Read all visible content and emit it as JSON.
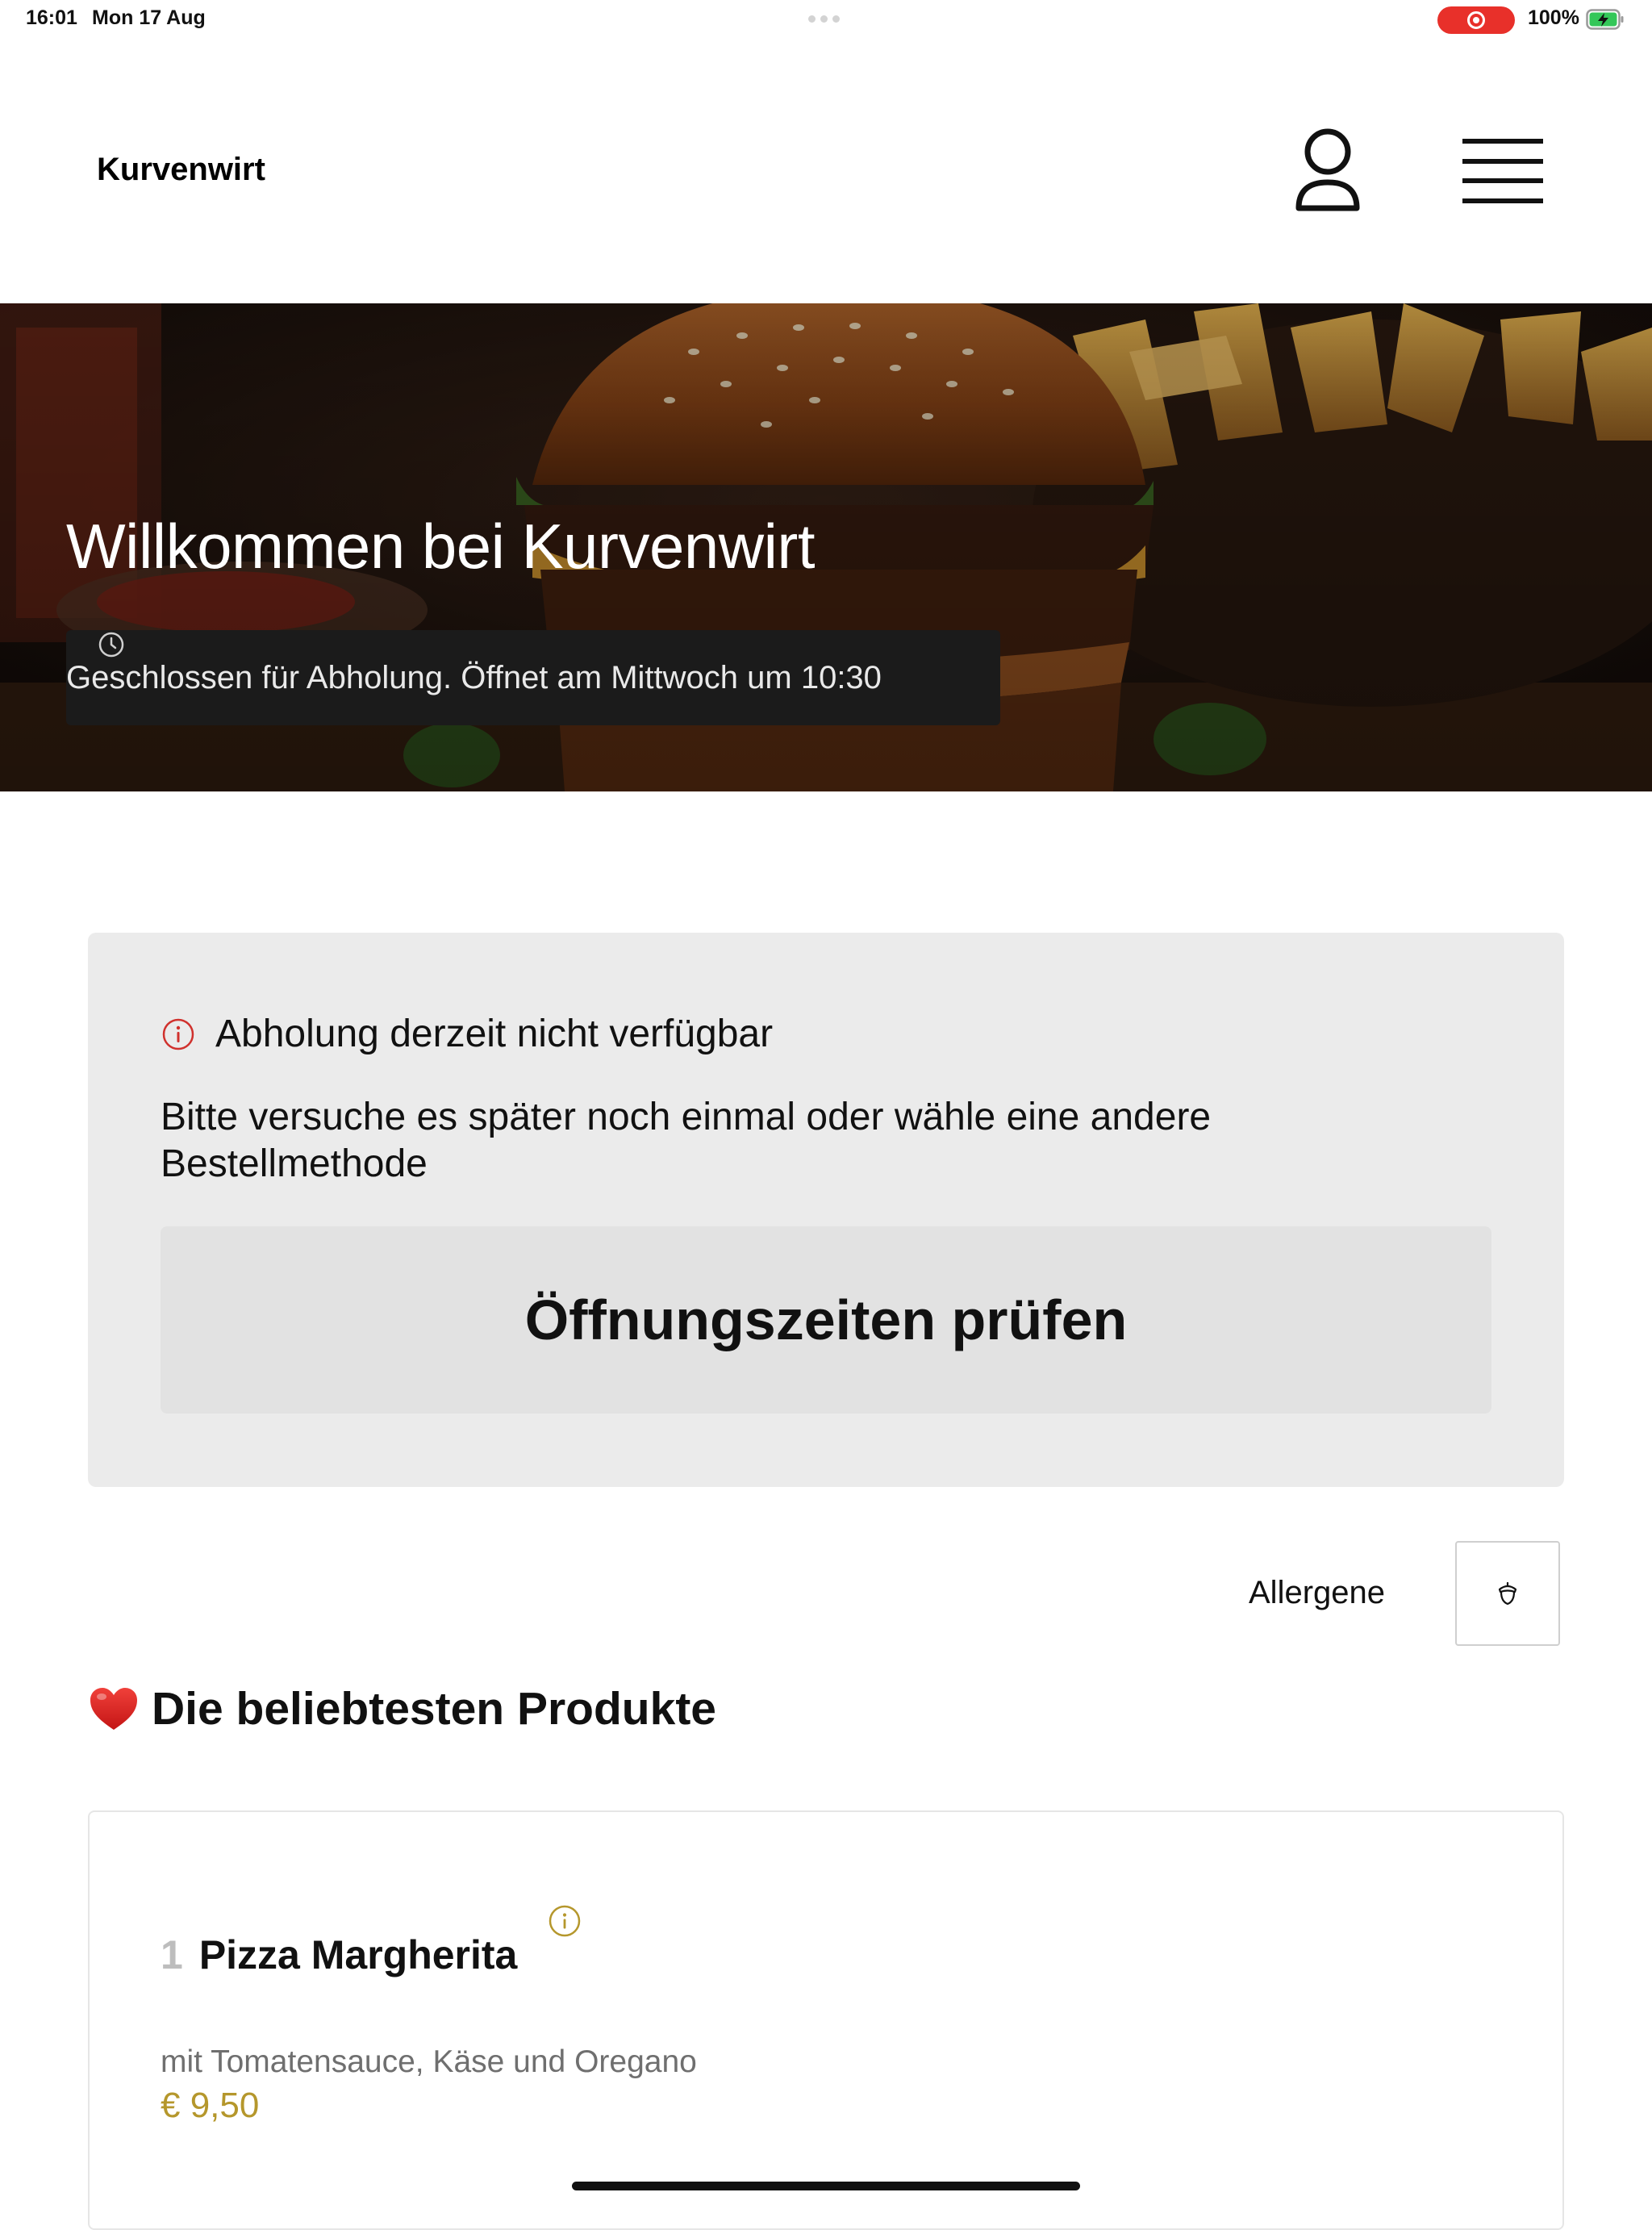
{
  "status_bar": {
    "time": "16:01",
    "date": "Mon 17 Aug",
    "battery_percent": "100%",
    "record_color": "#e8302a",
    "battery_color": "#34c759"
  },
  "header": {
    "brand": "Kurvenwirt",
    "profile_icon": "user-icon",
    "menu_icon": "hamburger-menu-icon"
  },
  "hero": {
    "title": "Willkommen bei Kurvenwirt",
    "status_icon": "clock-icon",
    "status_text": "Geschlossen für Abholung. Öffnet am Mittwoch um 10:30"
  },
  "notice": {
    "icon": "info-circle-icon",
    "icon_color": "#d0312d",
    "title": "Abholung derzeit nicht verfügbar",
    "body": "Bitte versuche es später noch einmal oder wähle eine andere Bestellmethode",
    "button_label": "Öffnungszeiten prüfen"
  },
  "allergens": {
    "label": "Allergene",
    "icon": "acorn-icon"
  },
  "popular": {
    "icon": "heart-icon",
    "title": "Die beliebtesten Produkte",
    "products": [
      {
        "number": "1",
        "name": "Pizza Margherita",
        "description": "mit Tomatensauce, Käse und Oregano",
        "price": "€ 9,50",
        "info_icon": "info-circle-icon"
      }
    ]
  },
  "accent_color": "#b5972c"
}
